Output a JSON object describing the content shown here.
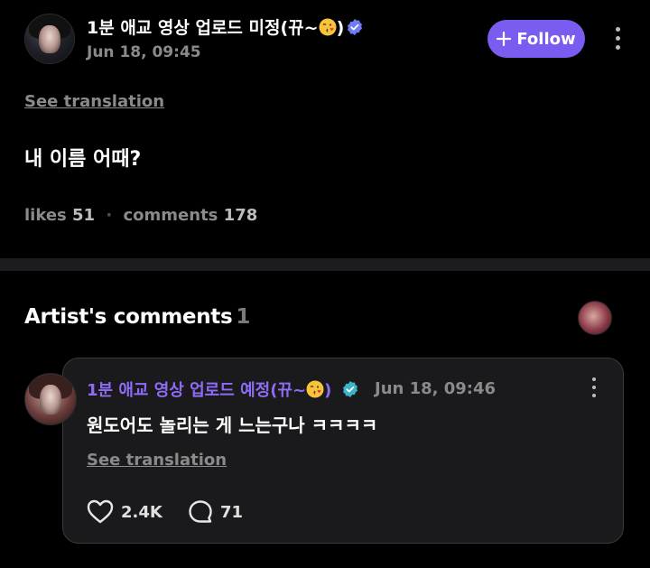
{
  "post": {
    "author_name": "1분 애교 영상 업로드 미정(뀨~",
    "author_name_suffix": ")",
    "date": "Jun 18, 09:45",
    "follow_label": "Follow",
    "see_translation": "See translation",
    "text": "내 이름 어때?",
    "likes_label": "likes",
    "likes_count": "51",
    "separator": "·",
    "comments_label": "comments",
    "comments_count": "178"
  },
  "artist_comments": {
    "title": "Artist's comments",
    "count": "1"
  },
  "comment": {
    "author_name": "1분 애교 영상 업로드 예정(뀨~",
    "author_name_suffix": ")",
    "date": "Jun 18, 09:46",
    "text": "원도어도 놀리는 게 느는구나 ㅋㅋㅋㅋ",
    "see_translation": "See translation",
    "likes": "2.4K",
    "replies": "71"
  },
  "colors": {
    "accent": "#7b5cf0",
    "artist_name": "#8e6cf5",
    "verified_post": "#6f7cf5",
    "verified_artist": "#3bb3c9",
    "muted_text": "#8a8a8a"
  },
  "icons": [
    "verified-badge-icon",
    "kissing-face-emoji",
    "plus-icon",
    "more-vertical-icon",
    "heart-icon",
    "comment-bubble-icon"
  ]
}
